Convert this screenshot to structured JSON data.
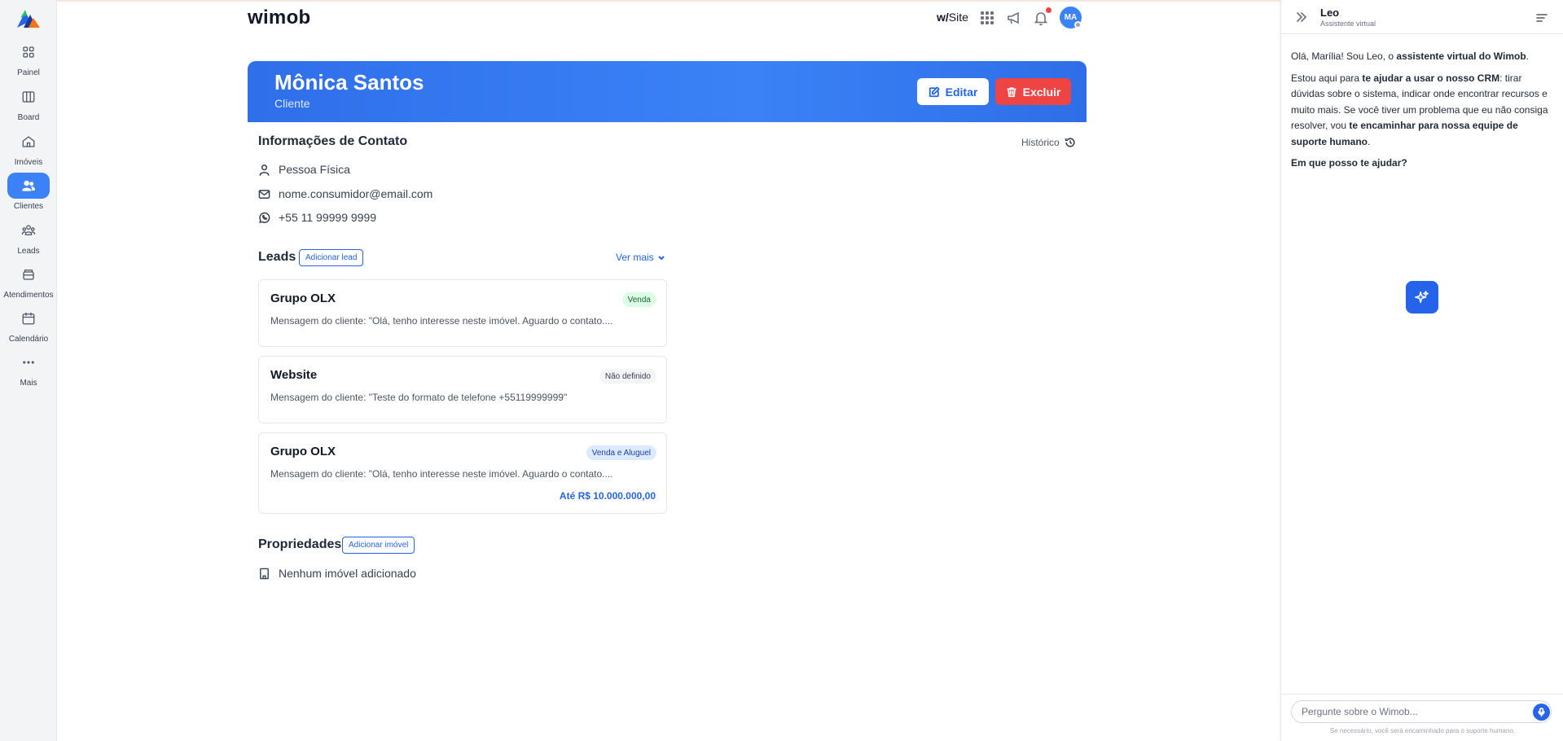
{
  "sidebar": {
    "items": [
      {
        "label": "Painel",
        "icon": "grid-icon"
      },
      {
        "label": "Board",
        "icon": "columns-icon"
      },
      {
        "label": "Imóveis",
        "icon": "home-icon"
      },
      {
        "label": "Clientes",
        "icon": "users-icon",
        "active": true
      },
      {
        "label": "Leads",
        "icon": "group-icon"
      },
      {
        "label": "Atendimentos",
        "icon": "inbox-icon"
      },
      {
        "label": "Calendário",
        "icon": "calendar-icon"
      },
      {
        "label": "Mais",
        "icon": "more-icon"
      }
    ]
  },
  "header": {
    "brand": "wimob",
    "wsite_prefix": "w/",
    "wsite_label": "Site",
    "avatar_initials": "MA"
  },
  "client": {
    "name": "Mônica Santos",
    "type": "Cliente",
    "edit_label": "Editar",
    "delete_label": "Excluir"
  },
  "contact": {
    "title": "Informações de Contato",
    "history_label": "Histórico",
    "person_type": "Pessoa Física",
    "email": "nome.consumidor@email.com",
    "phone": "+55 11 99999 9999"
  },
  "leads": {
    "title": "Leads",
    "add_label": "Adicionar lead",
    "more_label": "Ver mais",
    "items": [
      {
        "title": "Grupo OLX",
        "badge": "Venda",
        "message": "Mensagem do cliente: \"Olá, tenho interesse neste imóvel. Aguardo o contato....",
        "price": ""
      },
      {
        "title": "Website",
        "badge": "Não definido",
        "message": "Mensagem do cliente: \"Teste do formato de telefone +55119999999\"",
        "price": ""
      },
      {
        "title": "Grupo OLX",
        "badge": "Venda e Aluguel",
        "message": "Mensagem do cliente: \"Olá, tenho interesse neste imóvel. Aguardo o contato....",
        "price": "Até R$ 10.000.000,00"
      }
    ]
  },
  "properties": {
    "title": "Propriedades",
    "add_label": "Adicionar imóvel",
    "empty_label": "Nenhum imóvel adicionado"
  },
  "assistant": {
    "name": "Leo",
    "subtitle": "Assistente virtual",
    "p1_a": "Olá, Marília! Sou Leo, o ",
    "p1_b": "assistente virtual do Wimob",
    "p1_c": ".",
    "p2_a": "Estou aqui para ",
    "p2_b": "te ajudar a usar o nosso CRM",
    "p2_c": ": tirar dúvidas sobre o sistema, indicar onde encontrar recursos e muito mais. Se você tiver um problema que eu não consiga resolver, vou ",
    "p2_d": "te encaminhar para nossa equipe de suporte humano",
    "p2_e": ".",
    "p3": "Em que posso te ajudar?",
    "input_placeholder": "Pergunte sobre o Wimob...",
    "footer": "Se necessário, você será encaminhado para o suporte humano."
  },
  "colors": {
    "primary": "#3b82f6",
    "danger": "#ef4444",
    "badge_green": "#dcfce7",
    "badge_blue": "#dbeafe"
  }
}
